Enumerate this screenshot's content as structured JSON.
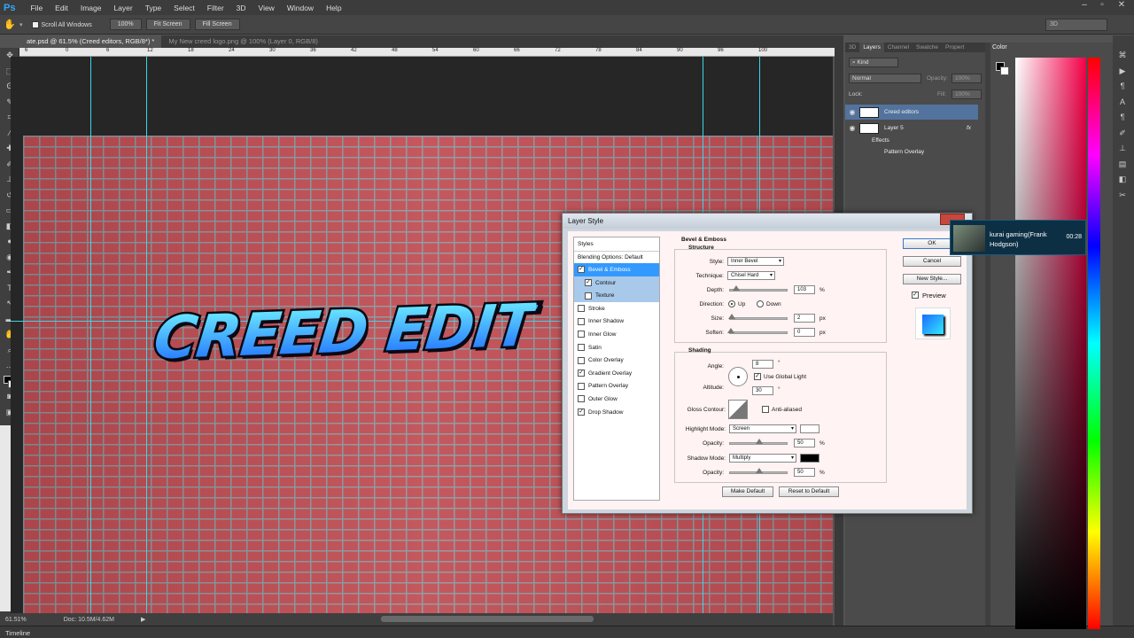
{
  "app": {
    "logo": "Ps"
  },
  "menu": [
    "File",
    "Edit",
    "Image",
    "Layer",
    "Type",
    "Select",
    "Filter",
    "3D",
    "View",
    "Window",
    "Help"
  ],
  "options": {
    "scroll_all": "Scroll All Windows",
    "zoom100": "100%",
    "fit_screen": "Fit Screen",
    "fill_screen": "Fill Screen",
    "workspace": "3D"
  },
  "tabs": [
    {
      "label": "ate.psd @ 61.5% (Creed  editors, RGB/8*) *"
    },
    {
      "label": "My New creed logo.png @ 100% (Layer 0, RGB/8)"
    }
  ],
  "ruler": {
    "h": [
      "6",
      "0",
      "6",
      "12",
      "18",
      "24",
      "30",
      "36",
      "42",
      "48",
      "54",
      "60",
      "66",
      "72",
      "78",
      "84",
      "90",
      "96",
      "100"
    ]
  },
  "canvas": {
    "text": "CREED EDIT"
  },
  "status": {
    "zoom": "61.51%",
    "doc": "Doc: 10.5M/4.62M"
  },
  "timeline": "Timeline",
  "layers_panel": {
    "tabs": [
      "3D",
      "Layers",
      "Channel",
      "Swatche",
      "Propert"
    ],
    "kind": "Kind",
    "blend": "Normal",
    "opacity_label": "Opacity:",
    "opacity": "100%",
    "lock": "Lock:",
    "fill_label": "Fill:",
    "fill": "100%",
    "layers": [
      {
        "name": "Creed  editors"
      },
      {
        "name": "Layer 5",
        "fx": "fx"
      }
    ],
    "effects_label": "Effects",
    "effect": "Pattern Overlay"
  },
  "color_panel": {
    "tab": "Color"
  },
  "dialog": {
    "title": "Layer Style",
    "styles_header": "Styles",
    "blending": "Blending Options: Default",
    "items": [
      {
        "label": "Bevel & Emboss",
        "checked": true
      },
      {
        "label": "Contour",
        "checked": true
      },
      {
        "label": "Texture",
        "checked": false
      },
      {
        "label": "Stroke",
        "checked": false
      },
      {
        "label": "Inner Shadow",
        "checked": false
      },
      {
        "label": "Inner Glow",
        "checked": false
      },
      {
        "label": "Satin",
        "checked": false
      },
      {
        "label": "Color Overlay",
        "checked": false
      },
      {
        "label": "Gradient Overlay",
        "checked": true
      },
      {
        "label": "Pattern Overlay",
        "checked": false
      },
      {
        "label": "Outer Glow",
        "checked": false
      },
      {
        "label": "Drop Shadow",
        "checked": true
      }
    ],
    "section": "Bevel & Emboss",
    "structure": "Structure",
    "style_label": "Style:",
    "style": "Inner Bevel",
    "technique_label": "Technique:",
    "technique": "Chisel Hard",
    "depth_label": "Depth:",
    "depth": "103",
    "pct": "%",
    "direction_label": "Direction:",
    "up": "Up",
    "down": "Down",
    "size_label": "Size:",
    "size": "2",
    "px": "px",
    "soften_label": "Soften:",
    "soften": "0",
    "shading": "Shading",
    "angle_label": "Angle:",
    "angle": "8",
    "deg": "°",
    "global_light": "Use Global Light",
    "altitude_label": "Altitude:",
    "altitude": "30",
    "gloss_label": "Gloss Contour:",
    "anti": "Anti-aliased",
    "highlight_label": "Highlight Mode:",
    "highlight": "Screen",
    "opacity_label": "Opacity:",
    "h_opacity": "50",
    "shadow_label": "Shadow Mode:",
    "shadow": "Multiply",
    "s_opacity": "50",
    "make_default": "Make Default",
    "reset_default": "Reset to Default",
    "ok": "OK",
    "cancel": "Cancel",
    "new_style": "New Style...",
    "preview": "Preview"
  },
  "notification": {
    "text": "kurai gaming(Frank Hodgson)",
    "time": "00:28"
  }
}
